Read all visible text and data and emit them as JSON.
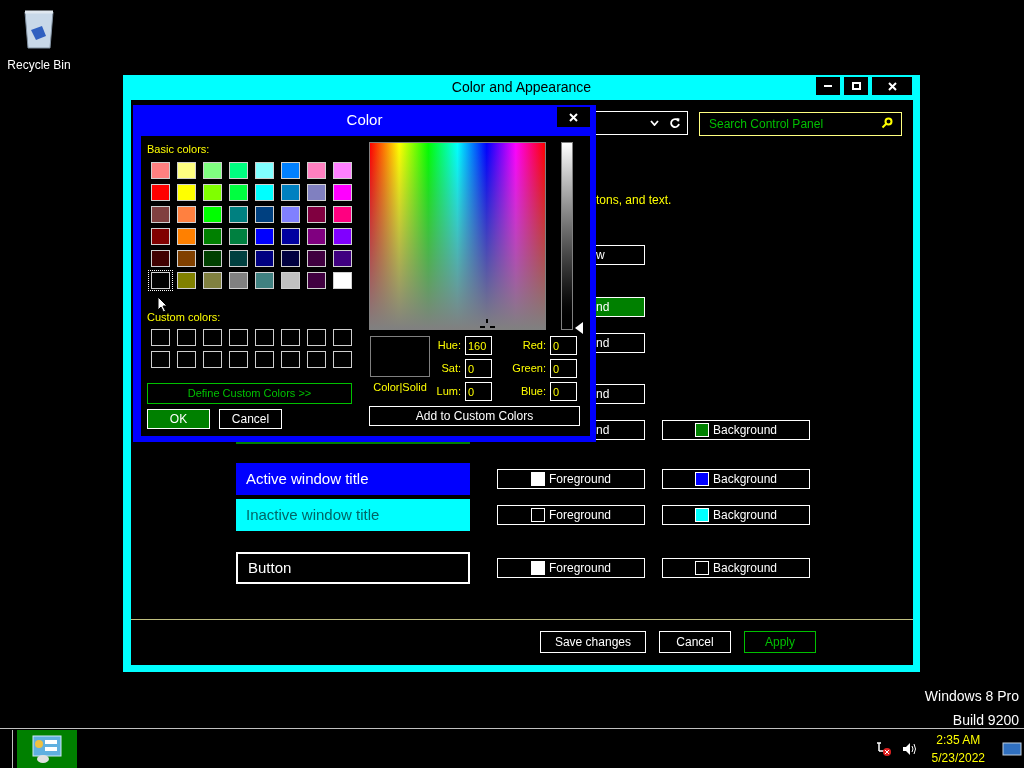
{
  "desktop": {
    "icons": [
      {
        "label": "Recycle Bin"
      }
    ],
    "os_version": [
      "Windows 8 Pro",
      "Build 9200"
    ]
  },
  "window": {
    "title": "Color and Appearance",
    "search": {
      "placeholder": "Search Control Panel"
    },
    "description": "tons, and text.",
    "rows": [
      {
        "kind": "cut",
        "foreground": {
          "label": "w",
          "selected": false
        }
      },
      {
        "kind": "cut",
        "foreground": {
          "label": "nd",
          "selected": true
        }
      },
      {
        "kind": "cut",
        "foreground": {
          "label": "nd",
          "selected": false
        }
      },
      {
        "kind": "cut",
        "foreground": {
          "label": "nd",
          "selected": false
        }
      },
      {
        "kind": "cut",
        "foreground": {
          "label": "nd",
          "selected": false
        },
        "background": {
          "label": "Background",
          "color": "#008000"
        }
      },
      {
        "kind": "edge",
        "preview": {
          "color": "#008000"
        }
      },
      {
        "kind": "full",
        "preview": {
          "kind": "filled",
          "label": "Active window title",
          "color": "#0000ff",
          "dark_text": false
        },
        "foreground": {
          "label": "Foreground",
          "color": "#ffffff"
        },
        "background": {
          "label": "Background",
          "color": "#0000ff"
        }
      },
      {
        "kind": "full",
        "preview": {
          "kind": "filled",
          "label": "Inactive window title",
          "color": "#00ffff",
          "dark_text": true
        },
        "foreground": {
          "label": "Foreground",
          "color": "#000000"
        },
        "background": {
          "label": "Background",
          "color": "#00ffff"
        }
      },
      {
        "kind": "full",
        "preview": {
          "kind": "outlined",
          "label": "Button",
          "color": "#000000",
          "dark_text": false
        },
        "foreground": {
          "label": "Foreground",
          "color": "#ffffff"
        },
        "background": {
          "label": "Background",
          "color": "#000000"
        }
      }
    ],
    "buttons": [
      {
        "label": "Save changes",
        "disabled": false
      },
      {
        "label": "Cancel",
        "disabled": false
      },
      {
        "label": "Apply",
        "disabled": true
      }
    ]
  },
  "dialog": {
    "title": "Color",
    "basic_label": "Basic colors:",
    "basic_colors": [
      {
        "color": "#ff8080",
        "selected": false
      },
      {
        "color": "#ffff80",
        "selected": false
      },
      {
        "color": "#80ff80",
        "selected": false
      },
      {
        "color": "#00ff80",
        "selected": false
      },
      {
        "color": "#80ffff",
        "selected": false
      },
      {
        "color": "#0080ff",
        "selected": false
      },
      {
        "color": "#ff80c0",
        "selected": false
      },
      {
        "color": "#ff80ff",
        "selected": false
      },
      {
        "color": "#ff0000",
        "selected": false
      },
      {
        "color": "#ffff00",
        "selected": false
      },
      {
        "color": "#80ff00",
        "selected": false
      },
      {
        "color": "#00ff40",
        "selected": false
      },
      {
        "color": "#00ffff",
        "selected": false
      },
      {
        "color": "#0080c0",
        "selected": false
      },
      {
        "color": "#8080c0",
        "selected": false
      },
      {
        "color": "#ff00ff",
        "selected": false
      },
      {
        "color": "#804040",
        "selected": false
      },
      {
        "color": "#ff8040",
        "selected": false
      },
      {
        "color": "#00ff00",
        "selected": false
      },
      {
        "color": "#008080",
        "selected": false
      },
      {
        "color": "#004080",
        "selected": false
      },
      {
        "color": "#8080ff",
        "selected": false
      },
      {
        "color": "#800040",
        "selected": false
      },
      {
        "color": "#ff0080",
        "selected": false
      },
      {
        "color": "#800000",
        "selected": false
      },
      {
        "color": "#ff8000",
        "selected": false
      },
      {
        "color": "#008000",
        "selected": false
      },
      {
        "color": "#008040",
        "selected": false
      },
      {
        "color": "#0000ff",
        "selected": false
      },
      {
        "color": "#0000a0",
        "selected": false
      },
      {
        "color": "#800080",
        "selected": false
      },
      {
        "color": "#8000ff",
        "selected": false
      },
      {
        "color": "#400000",
        "selected": false
      },
      {
        "color": "#804000",
        "selected": false
      },
      {
        "color": "#004000",
        "selected": false
      },
      {
        "color": "#004040",
        "selected": false
      },
      {
        "color": "#000080",
        "selected": false
      },
      {
        "color": "#000040",
        "selected": false
      },
      {
        "color": "#400040",
        "selected": false
      },
      {
        "color": "#400080",
        "selected": false
      },
      {
        "color": "#000000",
        "selected": true
      },
      {
        "color": "#808000",
        "selected": false
      },
      {
        "color": "#808040",
        "selected": false
      },
      {
        "color": "#808080",
        "selected": false
      },
      {
        "color": "#408080",
        "selected": false
      },
      {
        "color": "#c0c0c0",
        "selected": false
      },
      {
        "color": "#400040",
        "selected": false
      },
      {
        "color": "#ffffff",
        "selected": false
      }
    ],
    "custom_label": "Custom colors:",
    "custom_colors": [
      {
        "color": "#000000"
      },
      {
        "color": "#000000"
      },
      {
        "color": "#000000"
      },
      {
        "color": "#000000"
      },
      {
        "color": "#000000"
      },
      {
        "color": "#000000"
      },
      {
        "color": "#000000"
      },
      {
        "color": "#000000"
      },
      {
        "color": "#000000"
      },
      {
        "color": "#000000"
      },
      {
        "color": "#000000"
      },
      {
        "color": "#000000"
      },
      {
        "color": "#000000"
      },
      {
        "color": "#000000"
      },
      {
        "color": "#000000"
      },
      {
        "color": "#000000"
      }
    ],
    "define_button": {
      "label": "Define Custom Colors >>",
      "disabled": true
    },
    "ok_button": "OK",
    "cancel_button": "Cancel",
    "color_solid_label": "Color|Solid",
    "fields": [
      {
        "label": "Hue:",
        "value": "160"
      },
      {
        "label": "Red:",
        "value": "0"
      },
      {
        "label": "Sat:",
        "value": "0"
      },
      {
        "label": "Green:",
        "value": "0"
      },
      {
        "label": "Lum:",
        "value": "0"
      },
      {
        "label": "Blue:",
        "value": "0"
      }
    ],
    "luminance": {
      "level": 0
    },
    "add_button": "Add to Custom Colors"
  },
  "taskbar": {
    "apps": [
      {
        "selected": true
      }
    ],
    "time": "2:35 AM",
    "date": "5/23/2022"
  }
}
